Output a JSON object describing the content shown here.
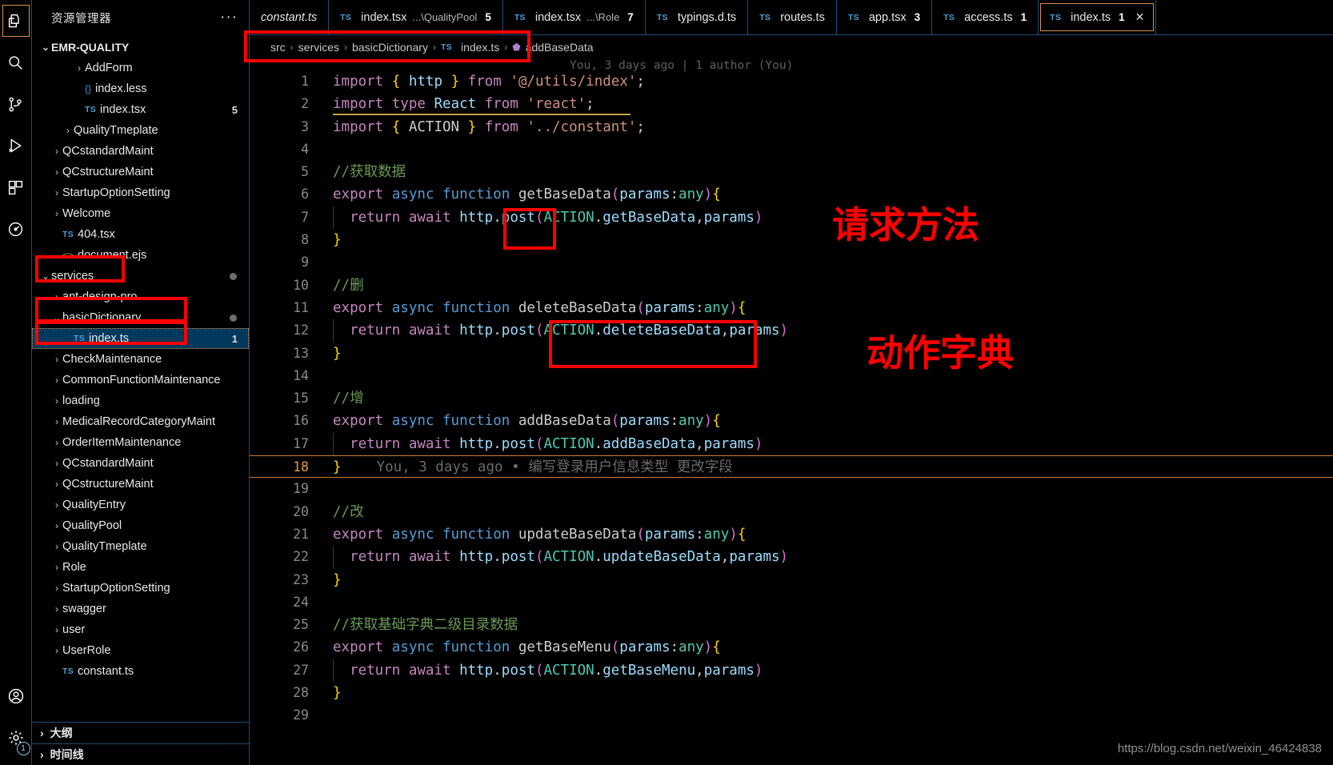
{
  "activity_bar": {
    "items": [
      {
        "name": "explorer-icon",
        "label": "资源管理器",
        "active": true
      },
      {
        "name": "search-icon",
        "label": "搜索",
        "active": false
      },
      {
        "name": "source-control-icon",
        "label": "源代码管理",
        "active": false
      },
      {
        "name": "run-debug-icon",
        "label": "运行和调试",
        "active": false
      },
      {
        "name": "extensions-icon",
        "label": "扩展",
        "active": false
      },
      {
        "name": "timeline-icon",
        "label": "时间线",
        "active": false
      }
    ],
    "bottom": [
      {
        "name": "account-icon",
        "label": "账户",
        "badge": ""
      },
      {
        "name": "settings-gear-icon",
        "label": "管理",
        "badge": "1"
      }
    ]
  },
  "sidebar": {
    "title": "资源管理器",
    "more_actions": "···",
    "tree": [
      {
        "label": "EMR-QUALITY",
        "indent": 0,
        "chevron": "⌄",
        "kind": "root",
        "badge": "",
        "modified": false
      },
      {
        "label": "AddForm",
        "indent": 3,
        "chevron": "›",
        "kind": "folder",
        "badge": "",
        "modified": false
      },
      {
        "label": "index.less",
        "indent": 3,
        "chevron": "",
        "kind": "less",
        "badge": "",
        "modified": false
      },
      {
        "label": "index.tsx",
        "indent": 3,
        "chevron": "",
        "kind": "ts",
        "badge": "5",
        "modified": false
      },
      {
        "label": "QualityTmeplate",
        "indent": 2,
        "chevron": "›",
        "kind": "folder",
        "badge": "",
        "modified": false
      },
      {
        "label": "QCstandardMaint",
        "indent": 1,
        "chevron": "›",
        "kind": "folder",
        "badge": "",
        "modified": false
      },
      {
        "label": "QCstructureMaint",
        "indent": 1,
        "chevron": "›",
        "kind": "folder",
        "badge": "",
        "modified": false
      },
      {
        "label": "StartupOptionSetting",
        "indent": 1,
        "chevron": "›",
        "kind": "folder",
        "badge": "",
        "modified": false
      },
      {
        "label": "Welcome",
        "indent": 1,
        "chevron": "›",
        "kind": "folder",
        "badge": "",
        "modified": false
      },
      {
        "label": "404.tsx",
        "indent": 1,
        "chevron": "",
        "kind": "ts",
        "badge": "",
        "modified": false
      },
      {
        "label": "document.ejs",
        "indent": 1,
        "chevron": "",
        "kind": "ejs",
        "badge": "",
        "modified": false
      },
      {
        "label": "services",
        "indent": 0,
        "chevron": "⌄",
        "kind": "folder",
        "badge": "",
        "modified": true
      },
      {
        "label": "ant-design-pro",
        "indent": 1,
        "chevron": "›",
        "kind": "folder",
        "badge": "",
        "modified": false
      },
      {
        "label": "basicDictionary",
        "indent": 1,
        "chevron": "⌄",
        "kind": "folder",
        "badge": "",
        "modified": true
      },
      {
        "label": "index.ts",
        "indent": 2,
        "chevron": "",
        "kind": "ts",
        "badge": "1",
        "modified": false,
        "selected": true
      },
      {
        "label": "CheckMaintenance",
        "indent": 1,
        "chevron": "›",
        "kind": "folder",
        "badge": "",
        "modified": false
      },
      {
        "label": "CommonFunctionMaintenance",
        "indent": 1,
        "chevron": "›",
        "kind": "folder",
        "badge": "",
        "modified": false
      },
      {
        "label": "loading",
        "indent": 1,
        "chevron": "›",
        "kind": "folder",
        "badge": "",
        "modified": false
      },
      {
        "label": "MedicalRecordCategoryMaint",
        "indent": 1,
        "chevron": "›",
        "kind": "folder",
        "badge": "",
        "modified": false
      },
      {
        "label": "OrderItemMaintenance",
        "indent": 1,
        "chevron": "›",
        "kind": "folder",
        "badge": "",
        "modified": false
      },
      {
        "label": "QCstandardMaint",
        "indent": 1,
        "chevron": "›",
        "kind": "folder",
        "badge": "",
        "modified": false
      },
      {
        "label": "QCstructureMaint",
        "indent": 1,
        "chevron": "›",
        "kind": "folder",
        "badge": "",
        "modified": false
      },
      {
        "label": "QualityEntry",
        "indent": 1,
        "chevron": "›",
        "kind": "folder",
        "badge": "",
        "modified": false
      },
      {
        "label": "QualityPool",
        "indent": 1,
        "chevron": "›",
        "kind": "folder",
        "badge": "",
        "modified": false
      },
      {
        "label": "QualityTmeplate",
        "indent": 1,
        "chevron": "›",
        "kind": "folder",
        "badge": "",
        "modified": false
      },
      {
        "label": "Role",
        "indent": 1,
        "chevron": "›",
        "kind": "folder",
        "badge": "",
        "modified": false
      },
      {
        "label": "StartupOptionSetting",
        "indent": 1,
        "chevron": "›",
        "kind": "folder",
        "badge": "",
        "modified": false
      },
      {
        "label": "swagger",
        "indent": 1,
        "chevron": "›",
        "kind": "folder",
        "badge": "",
        "modified": false
      },
      {
        "label": "user",
        "indent": 1,
        "chevron": "›",
        "kind": "folder",
        "badge": "",
        "modified": false
      },
      {
        "label": "UserRole",
        "indent": 1,
        "chevron": "›",
        "kind": "folder",
        "badge": "",
        "modified": false
      },
      {
        "label": "constant.ts",
        "indent": 1,
        "chevron": "",
        "kind": "ts",
        "badge": "",
        "modified": false
      }
    ],
    "panels": [
      {
        "label": "大纲",
        "chevron": "›"
      },
      {
        "label": "时间线",
        "chevron": "›"
      }
    ]
  },
  "tabs": [
    {
      "name": "constant.ts",
      "path": "",
      "count": "",
      "icon": "",
      "italic": true,
      "active": false,
      "close": false
    },
    {
      "name": "index.tsx",
      "path": "...\\QualityPool",
      "count": "5",
      "icon": "TS",
      "italic": false,
      "active": false,
      "close": false
    },
    {
      "name": "index.tsx",
      "path": "...\\Role",
      "count": "7",
      "icon": "TS",
      "italic": false,
      "active": false,
      "close": false
    },
    {
      "name": "typings.d.ts",
      "path": "",
      "count": "",
      "icon": "TS",
      "italic": false,
      "active": false,
      "close": false
    },
    {
      "name": "routes.ts",
      "path": "",
      "count": "",
      "icon": "TS",
      "italic": false,
      "active": false,
      "close": false
    },
    {
      "name": "app.tsx",
      "path": "",
      "count": "3",
      "icon": "TS",
      "italic": false,
      "active": false,
      "close": false
    },
    {
      "name": "access.ts",
      "path": "",
      "count": "1",
      "icon": "TS",
      "italic": false,
      "active": false,
      "close": false
    },
    {
      "name": "index.ts",
      "path": "",
      "count": "1",
      "icon": "TS",
      "italic": false,
      "active": true,
      "close": true
    }
  ],
  "breadcrumb": {
    "items": [
      "src",
      "services",
      "basicDictionary",
      "index.ts",
      "addBaseData"
    ],
    "separator": "›",
    "file_icon": "TS",
    "symbol_icon": "⬟"
  },
  "blame_header": "You, 3 days ago | 1 author (You)",
  "blame_inline": "You, 3 days ago • 编写登录用户信息类型 更改字段",
  "code_lines": [
    {
      "n": "1",
      "text": "import { http } from '@/utils/index';"
    },
    {
      "n": "2",
      "text": "import type React from 'react';"
    },
    {
      "n": "3",
      "text": "import { ACTION } from '../constant';"
    },
    {
      "n": "4",
      "text": ""
    },
    {
      "n": "5",
      "text": "//获取数据"
    },
    {
      "n": "6",
      "text": "export async function getBaseData(params:any){"
    },
    {
      "n": "7",
      "text": "  return await http.post(ACTION.getBaseData,params)"
    },
    {
      "n": "8",
      "text": "}"
    },
    {
      "n": "9",
      "text": ""
    },
    {
      "n": "10",
      "text": "//删"
    },
    {
      "n": "11",
      "text": "export async function deleteBaseData(params:any){"
    },
    {
      "n": "12",
      "text": "  return await http.post(ACTION.deleteBaseData,params)"
    },
    {
      "n": "13",
      "text": "}"
    },
    {
      "n": "14",
      "text": ""
    },
    {
      "n": "15",
      "text": "//增"
    },
    {
      "n": "16",
      "text": "export async function addBaseData(params:any){"
    },
    {
      "n": "17",
      "text": "  return await http.post(ACTION.addBaseData,params)"
    },
    {
      "n": "18",
      "text": "}"
    },
    {
      "n": "19",
      "text": ""
    },
    {
      "n": "20",
      "text": "//改"
    },
    {
      "n": "21",
      "text": "export async function updateBaseData(params:any){"
    },
    {
      "n": "22",
      "text": "  return await http.post(ACTION.updateBaseData,params)"
    },
    {
      "n": "23",
      "text": "}"
    },
    {
      "n": "24",
      "text": ""
    },
    {
      "n": "25",
      "text": "//获取基础字典二级目录数据"
    },
    {
      "n": "26",
      "text": "export async function getBaseMenu(params:any){"
    },
    {
      "n": "27",
      "text": "  return await http.post(ACTION.getBaseMenu,params)"
    },
    {
      "n": "28",
      "text": "}"
    },
    {
      "n": "29",
      "text": ""
    }
  ],
  "annotations": {
    "label_request_method": "请求方法",
    "label_action_dictionary": "动作字典",
    "color": "#ff0000"
  },
  "watermark": "https://blog.csdn.net/weixin_46424838"
}
